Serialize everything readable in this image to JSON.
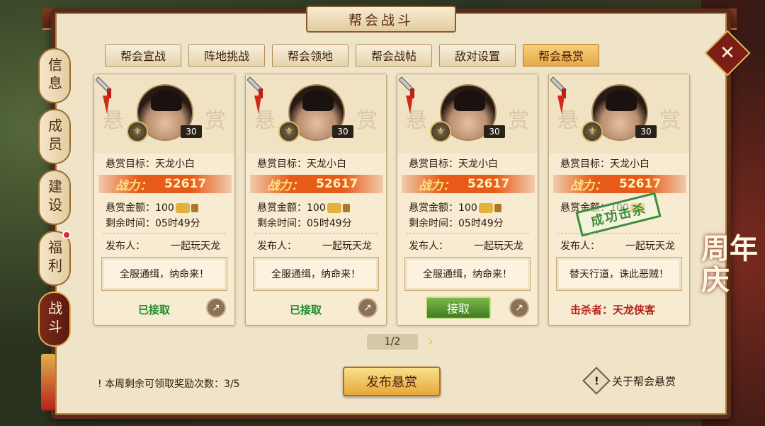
{
  "title": "帮会战斗",
  "side_tabs": [
    {
      "label": "信息",
      "active": false,
      "dot": false
    },
    {
      "label": "成员",
      "active": false,
      "dot": false
    },
    {
      "label": "建设",
      "active": false,
      "dot": false
    },
    {
      "label": "福利",
      "active": false,
      "dot": true
    },
    {
      "label": "战斗",
      "active": true,
      "dot": false
    }
  ],
  "tabs": [
    {
      "label": "帮会宣战",
      "active": false
    },
    {
      "label": "阵地挑战",
      "active": false
    },
    {
      "label": "帮会领地",
      "active": false
    },
    {
      "label": "帮会战帖",
      "active": false
    },
    {
      "label": "敌对设置",
      "active": false
    },
    {
      "label": "帮会悬赏",
      "active": true
    }
  ],
  "watermark": {
    "left": "悬",
    "right": "赏"
  },
  "cards": [
    {
      "level": "30",
      "target_label": "悬赏目标：",
      "target": "天龙小白",
      "power_label": "战力：",
      "power": "52617",
      "reward_label": "悬赏金额：",
      "reward": "100",
      "time_label": "剩余时间：",
      "time": "05时49分",
      "publisher_label": "发布人：",
      "publisher": "一起玩天龙",
      "message": "全服通缉，纳命来！",
      "status": "已接取"
    },
    {
      "level": "30",
      "target_label": "悬赏目标：",
      "target": "天龙小白",
      "power_label": "战力：",
      "power": "52617",
      "reward_label": "悬赏金额：",
      "reward": "100",
      "time_label": "剩余时间：",
      "time": "05时49分",
      "publisher_label": "发布人：",
      "publisher": "一起玩天龙",
      "message": "全服通缉，纳命来！",
      "status": "已接取"
    },
    {
      "level": "30",
      "target_label": "悬赏目标：",
      "target": "天龙小白",
      "power_label": "战力：",
      "power": "52617",
      "reward_label": "悬赏金额：",
      "reward": "100",
      "time_label": "剩余时间：",
      "time": "05时49分",
      "publisher_label": "发布人：",
      "publisher": "一起玩天龙",
      "message": "全服通缉，纳命来！",
      "accept_label": "接取"
    },
    {
      "level": "30",
      "target_label": "悬赏目标：",
      "target": "天龙小白",
      "power_label": "战力：",
      "power": "52617",
      "reward_label": "悬赏金额：",
      "reward": "100",
      "publisher_label": "发布人：",
      "publisher": "一起玩天龙",
      "message": "替天行道，诛此恶贼！",
      "stamp": "成功击杀",
      "killer_label": "击杀者：",
      "killer": "天龙侠客"
    }
  ],
  "pager": "1/2",
  "weekly_info": "本周剩余可领取奖励次数：3/5",
  "publish_button": "发布悬赏",
  "about_label": "关于帮会悬赏",
  "anniversary": "周年庆",
  "colors": {
    "accent_gold": "#e7a84a",
    "frame_red": "#5a2a1a",
    "status_green": "#1f8a2a",
    "killer_red": "#b8201a"
  },
  "icons": {
    "close": "close-icon",
    "share": "share-icon",
    "gold": "gold-ingot-icon",
    "lock": "lock-icon",
    "badge": "rank-badge-icon",
    "sword": "sword-icon"
  }
}
